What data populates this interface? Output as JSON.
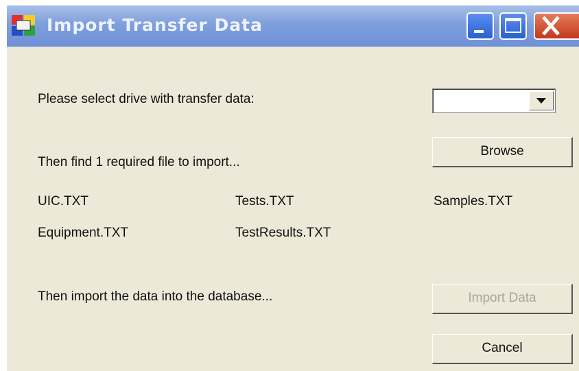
{
  "window": {
    "title": "Import Transfer Data",
    "accent": "#7f9fdc",
    "face_color": "#ece9d8"
  },
  "titlebar_buttons": {
    "minimize": "minimize-icon",
    "maximize": "maximize-icon",
    "close": "close-icon"
  },
  "labels": {
    "select_drive": "Please select drive with transfer data:",
    "find_file": "Then find 1 required file to import...",
    "import_prompt": "Then import the data into the database..."
  },
  "drive_select": {
    "value": ""
  },
  "files": [
    "UIC.TXT",
    "Tests.TXT",
    "Samples.TXT",
    "Equipment.TXT",
    "TestResults.TXT"
  ],
  "buttons": {
    "browse": "Browse",
    "import_data": "Import Data",
    "cancel": "Cancel"
  }
}
